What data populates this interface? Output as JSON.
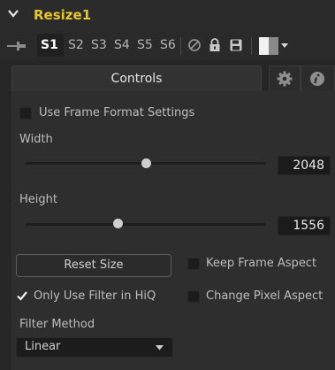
{
  "tool": {
    "title": "Resize1",
    "title_color": "#e8c52b"
  },
  "toolbar": {
    "slots": [
      "S1",
      "S2",
      "S3",
      "S4",
      "S5",
      "S6"
    ],
    "active_slot": "S1",
    "icons": [
      "pin-icon",
      "bypass-icon",
      "lock-icon",
      "save-icon",
      "color-swatch-icon",
      "chevron-down-icon"
    ]
  },
  "tabs": {
    "controls_label": "Controls",
    "settings_icon": "gear-icon",
    "info_icon": "info-icon"
  },
  "controls": {
    "use_frame_format": {
      "label": "Use Frame Format Settings",
      "checked": false
    },
    "width": {
      "label": "Width",
      "value": "2048"
    },
    "height": {
      "label": "Height",
      "value": "1556"
    },
    "reset_size_label": "Reset Size",
    "keep_frame_aspect": {
      "label": "Keep Frame Aspect",
      "checked": false
    },
    "only_filter_hiq": {
      "label": "Only Use Filter in HiQ",
      "checked": true
    },
    "change_pixel_aspect": {
      "label": "Change Pixel Aspect",
      "checked": false
    },
    "filter_method": {
      "label": "Filter Method",
      "value": "Linear"
    }
  }
}
